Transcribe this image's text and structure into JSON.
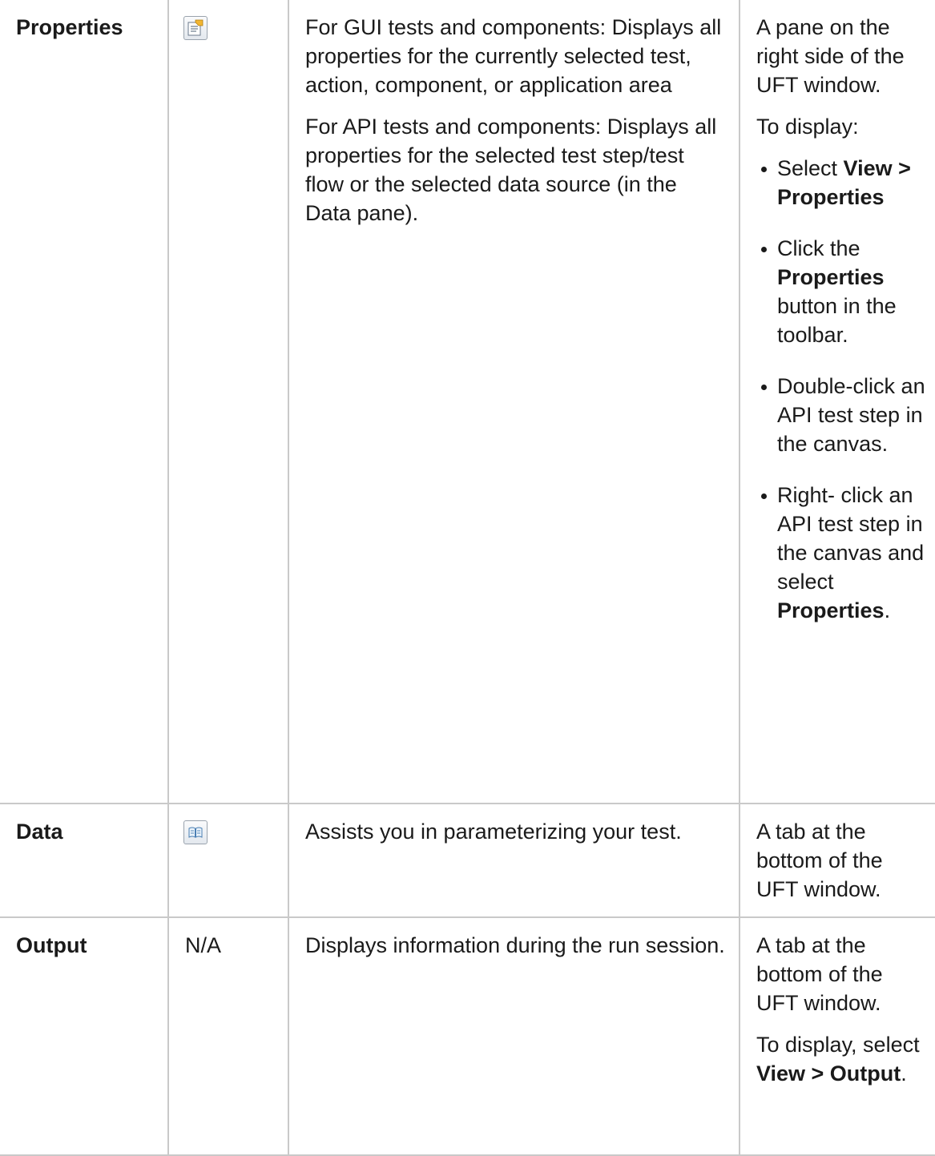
{
  "rows": [
    {
      "name": "Properties",
      "icon": "properties-icon",
      "desc_p1": "For GUI tests and components: Displays all properties for the currently selected test, action, component, or application area",
      "desc_p2": "For API tests and components: Displays all properties for the selected test step/test flow or the selected data source (in the Data pane).",
      "loc_p1": "A pane on the right side of the UFT window.",
      "loc_p2": "To display:",
      "bullets": [
        {
          "a": "Select ",
          "b": "View > Properties",
          "c": ""
        },
        {
          "a": "Click the ",
          "b": "Properties",
          "c": " button in the toolbar."
        },
        {
          "a": "Double-click an API test step in the canvas.",
          "b": "",
          "c": ""
        },
        {
          "a": "Right- click an API test step in the canvas and select ",
          "b": "Properties",
          "c": "."
        }
      ]
    },
    {
      "name": "Data",
      "icon": "data-book-icon",
      "desc_p1": "Assists you in parameterizing your test.",
      "loc_p1": "A tab at the bottom of the UFT window."
    },
    {
      "name": "Output",
      "icon_text": "N/A",
      "desc_p1": "Displays information during the run session.",
      "loc_p1": "A tab at the bottom of the UFT window.",
      "loc_p2_a": "To display, select ",
      "loc_p2_b": "View > Output",
      "loc_p2_c": "."
    }
  ]
}
